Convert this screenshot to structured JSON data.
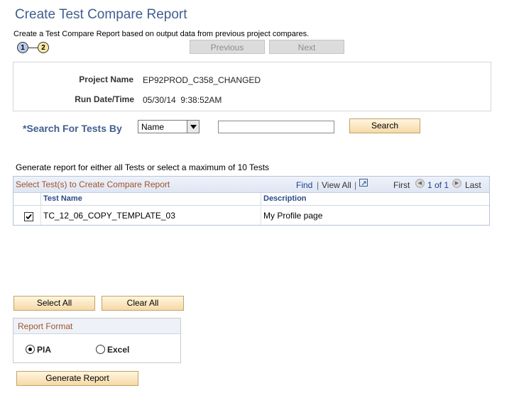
{
  "page": {
    "title": "Create Test Compare Report",
    "subtitle": "Create a Test Compare Report based on output data from previous project compares."
  },
  "steps": [
    "1",
    "2"
  ],
  "nav": {
    "previous": "Previous",
    "next": "Next"
  },
  "info": {
    "project_name_label": "Project Name",
    "project_name_value": "EP92PROD_C358_CHANGED",
    "run_datetime_label": "Run Date/Time",
    "run_datetime_value": "05/30/14  9:38:52AM"
  },
  "search": {
    "label": "*Search For Tests By",
    "selected_option": "Name",
    "input_value": "",
    "button": "Search"
  },
  "note": "Generate report for either all Tests or select a maximum of 10 Tests",
  "grid": {
    "title": "Select Test(s) to Create Compare Report",
    "find": "Find",
    "sep": "|",
    "view_all": "View All",
    "first": "First",
    "page_info": "1 of 1",
    "last": "Last",
    "columns": [
      "Test Name",
      "Description"
    ],
    "rows": [
      {
        "checked": true,
        "test_name": "TC_12_06_COPY_TEMPLATE_03",
        "description": "My Profile page"
      }
    ]
  },
  "buttons": {
    "select_all": "Select All",
    "clear_all": "Clear All",
    "generate_report": "Generate Report"
  },
  "report_format": {
    "title": "Report Format",
    "options": [
      {
        "label": "PIA",
        "selected": true
      },
      {
        "label": "Excel",
        "selected": false
      }
    ]
  }
}
